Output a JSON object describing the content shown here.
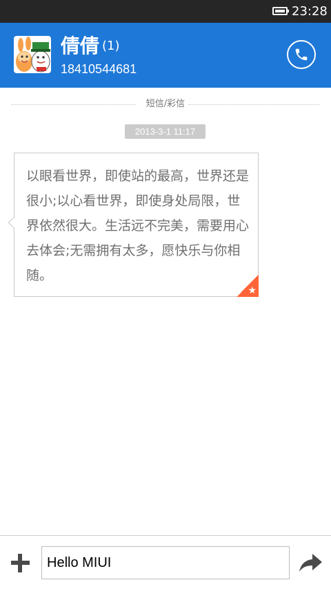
{
  "status_bar": {
    "time": "23:28",
    "battery_icon": "battery-full-icon"
  },
  "header": {
    "contact_name": "倩倩",
    "unread_count": "(1)",
    "phone_number": "18410544681",
    "avatar_icon": "cartoon-avatar-icon",
    "call_icon": "phone-icon",
    "background_color": "#1e78d8"
  },
  "conversation": {
    "type_label": "短信/彩信",
    "messages": [
      {
        "timestamp": "2013-3-1 11:17",
        "text": "以眼看世界，即使站的最高，世界还是很小;以心看世界，即使身处局限，世界依然很大。生活远不完美，需要用心去体会;无需拥有太多，愿快乐与你相随。",
        "starred": true,
        "star_color": "#ff6436"
      }
    ]
  },
  "composer": {
    "add_icon": "plus-icon",
    "input_value": "Hello MIUI",
    "send_icon": "send-arrow-icon"
  }
}
